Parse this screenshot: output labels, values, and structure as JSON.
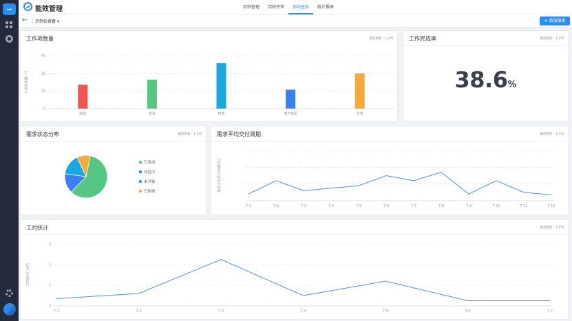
{
  "app": {
    "title": "能效管理"
  },
  "nav": {
    "items": [
      "用例管理",
      "用例评审",
      "测试任务",
      "统计报表"
    ],
    "active_index": 2
  },
  "toolbar": {
    "back_glyph": "←",
    "dashboard_select": "示例仪表盘 ▾",
    "add_button": "添加报表",
    "add_glyph": "+"
  },
  "colors": {
    "accent": "#2d8cf0",
    "red": "#f0554f",
    "green": "#55c783",
    "cyan": "#1aa8e0",
    "blue": "#3b7ff0",
    "orange": "#f3a93c"
  },
  "panels": {
    "work_items": {
      "title": "工作项数量",
      "meta": "最后更新：1小时"
    },
    "completion": {
      "title": "工作完成率",
      "meta": "最后更新：1小时",
      "value": "38.6",
      "unit": "%"
    },
    "req_status": {
      "title": "需求状态分布",
      "meta": "最后更新：1小时"
    },
    "delivery": {
      "title": "需求平均交付周期",
      "meta": "最后更新：1小时"
    },
    "hours": {
      "title": "工时统计",
      "meta": "最后更新：1小时"
    }
  },
  "chart_data": [
    {
      "id": "work_items",
      "type": "bar",
      "ylabel": "工作项数量(个)",
      "ylim": [
        0,
        42
      ],
      "yticks": [
        0,
        14,
        28,
        42
      ],
      "categories": [
        "缺陷",
        "史诗",
        "特性",
        "用户故事",
        "任务"
      ],
      "values": [
        19,
        23,
        36,
        15,
        28
      ],
      "colors": [
        "#f0554f",
        "#55c783",
        "#1aa8e0",
        "#3b7ff0",
        "#f3a93c"
      ],
      "grid": true
    },
    {
      "id": "req_status",
      "type": "pie",
      "labels": [
        "已完成",
        "评估中",
        "未开始",
        "已拒绝"
      ],
      "values": [
        59,
        15,
        16,
        10
      ],
      "colors": [
        "#55c783",
        "#3b7ff0",
        "#1aa8e0",
        "#f3a93c"
      ],
      "legend": "right"
    },
    {
      "id": "delivery",
      "type": "line",
      "ylabel": "需求平均交付周期(天)",
      "categories": [
        "7-1",
        "7-2",
        "7-3",
        "7-4",
        "7-5",
        "7-6",
        "7-7",
        "7-8",
        "7-9",
        "7-10",
        "7-11",
        "7-12"
      ],
      "values": [
        0.4,
        1.2,
        0.6,
        0.75,
        0.9,
        1.5,
        1.2,
        1.7,
        0.4,
        1.2,
        0.5,
        0.35
      ],
      "ylim": [
        0,
        3
      ],
      "grid": true
    },
    {
      "id": "hours",
      "type": "line",
      "ylabel": "工时统计(小时)",
      "categories": [
        "7-1",
        "7-2",
        "7-3",
        "7-4",
        "7-5",
        "7-6",
        "7-7"
      ],
      "values": [
        0.35,
        0.6,
        2.25,
        0.5,
        1.2,
        0.25,
        0.25
      ],
      "ylim": [
        0,
        3
      ],
      "yticks": [
        0,
        1,
        2,
        3
      ],
      "grid": true
    }
  ]
}
